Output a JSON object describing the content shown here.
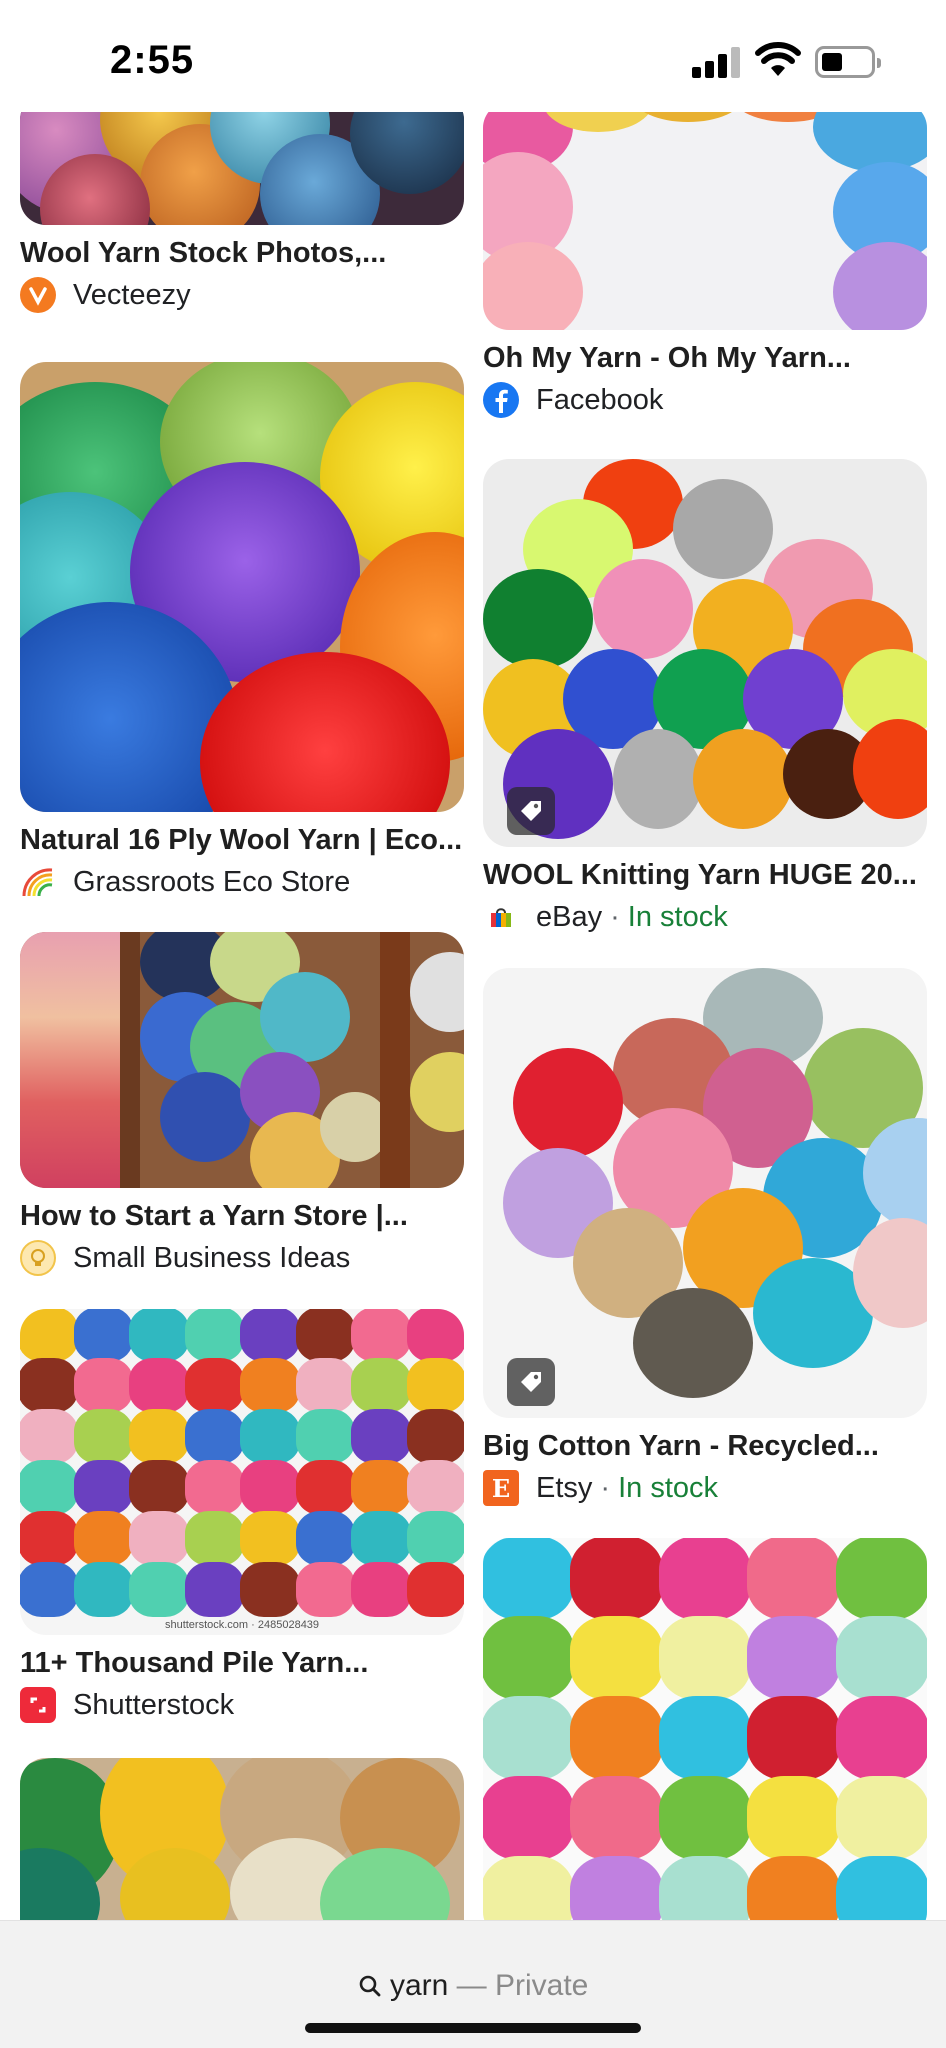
{
  "status_bar": {
    "time": "2:55"
  },
  "results": {
    "left": [
      {
        "title": "Wool Yarn Stock Photos,...",
        "source": "Vecteezy",
        "stock": ""
      },
      {
        "title": "Natural 16 Ply Wool Yarn | Eco...",
        "source": "Grassroots Eco Store",
        "stock": ""
      },
      {
        "title": "How to Start a Yarn Store |...",
        "source": "Small Business Ideas",
        "stock": ""
      },
      {
        "title": "11+ Thousand Pile Yarn...",
        "source": "Shutterstock",
        "stock": "",
        "watermark": "shutterstock.com · 2485028439"
      }
    ],
    "right": [
      {
        "title": "Oh My Yarn - Oh My Yarn...",
        "source": "Facebook",
        "stock": ""
      },
      {
        "title": "WOOL Knitting Yarn HUGE 20...",
        "source": "eBay",
        "stock": "In stock"
      },
      {
        "title": "Big Cotton Yarn - Recycled...",
        "source": "Etsy",
        "stock": "In stock"
      }
    ]
  },
  "search_bar": {
    "query": "yarn",
    "suffix": "— Private"
  },
  "icons": {
    "signal": "cellular-signal-icon",
    "wifi": "wifi-icon",
    "battery": "battery-icon",
    "search": "search-icon",
    "shopping_tag": "shopping-tag-icon"
  }
}
